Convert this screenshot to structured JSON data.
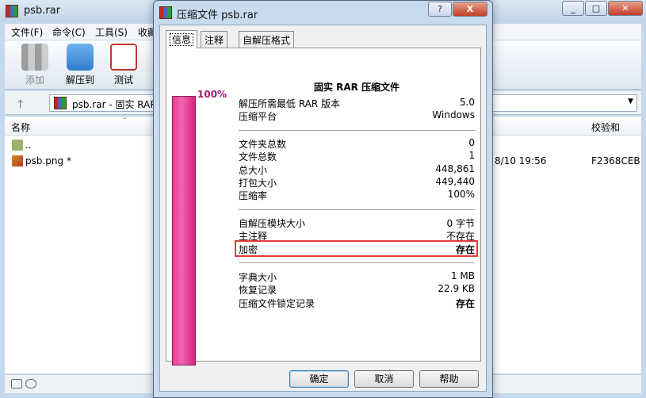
{
  "main": {
    "title": "psb.rar",
    "menu": [
      "文件(F)",
      "命令(C)",
      "工具(S)",
      "收藏"
    ],
    "toolbar": [
      "添加",
      "解压到",
      "测试"
    ],
    "path": "psb.rar - 固实 RAR",
    "columns": {
      "name": "名称",
      "crc": "校验和"
    },
    "rows": [
      {
        "name": "..",
        "modified": "",
        "crc": ""
      },
      {
        "name": "psb.png *",
        "modified": "8/10 19:56",
        "crc": "F2368CEB"
      }
    ]
  },
  "dialog": {
    "title": "压缩文件 psb.rar",
    "tabs": [
      "信息",
      "注释",
      "自解压格式"
    ],
    "ratio_label": "100%",
    "ratio_fill": 1.0,
    "heading": "固实 RAR 压缩文件",
    "group1": [
      {
        "k": "解压所需最低 RAR 版本",
        "v": "5.0"
      },
      {
        "k": "压缩平台",
        "v": "Windows"
      }
    ],
    "group2": [
      {
        "k": "文件夹总数",
        "v": "0"
      },
      {
        "k": "文件总数",
        "v": "1"
      },
      {
        "k": "总大小",
        "v": "448,861"
      },
      {
        "k": "打包大小",
        "v": "449,440"
      },
      {
        "k": "压缩率",
        "v": "100%"
      }
    ],
    "group3": [
      {
        "k": "自解压模块大小",
        "v": "0 字节"
      },
      {
        "k": "主注释",
        "v": "不存在"
      },
      {
        "k": "加密",
        "v": "存在"
      }
    ],
    "group4": [
      {
        "k": "字典大小",
        "v": "1 MB"
      },
      {
        "k": "恢复记录",
        "v": "22.9 KB"
      },
      {
        "k": "压缩文件锁定记录",
        "v": "存在"
      }
    ],
    "buttons": {
      "ok": "确定",
      "cancel": "取消",
      "help": "帮助"
    },
    "caption": {
      "help": "?",
      "close": "X"
    }
  },
  "colors": {
    "ratio_bar": "#e83e97",
    "highlight": "#e33b3b",
    "ratio_text": "#a0176c"
  }
}
